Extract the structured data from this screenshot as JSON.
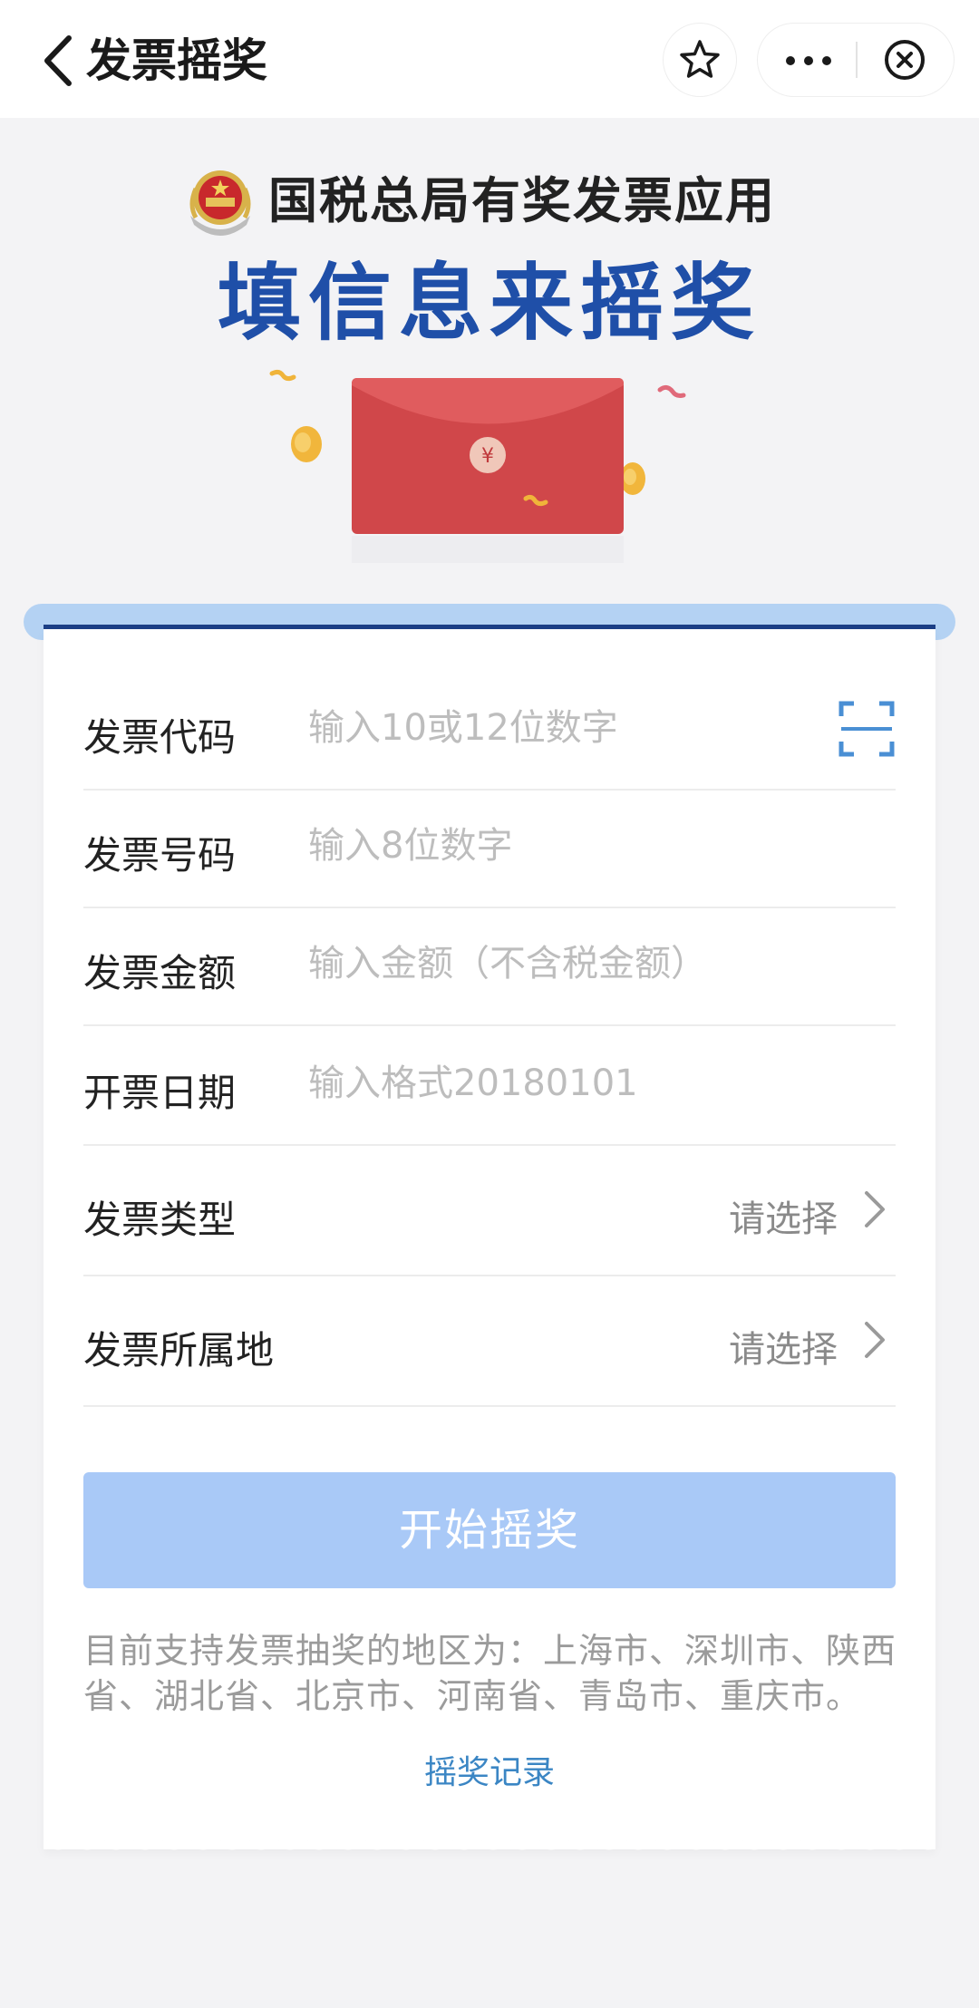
{
  "nav": {
    "title": "发票摇奖"
  },
  "banner": {
    "subtitle": "国税总局有奖发票应用",
    "headline": "填信息来摇奖",
    "envelope_symbol": "¥"
  },
  "form": {
    "fields": [
      {
        "label": "发票代码",
        "placeholder": "输入10或12位数字",
        "value": ""
      },
      {
        "label": "发票号码",
        "placeholder": "输入8位数字",
        "value": ""
      },
      {
        "label": "发票金额",
        "placeholder": "输入金额（不含税金额）",
        "value": ""
      },
      {
        "label": "开票日期",
        "placeholder": "输入格式20180101",
        "value": ""
      }
    ],
    "pickers": [
      {
        "label": "发票类型",
        "value": "请选择"
      },
      {
        "label": "发票所属地",
        "value": "请选择"
      }
    ],
    "start_button": "开始摇奖",
    "notice": "目前支持发票抽奖的地区为：上海市、深圳市、陕西省、湖北省、北京市、河南省、青岛市、重庆市。",
    "records_link": "摇奖记录"
  },
  "colors": {
    "headline": "#1f4fa8",
    "start_button": "#a9c9f7",
    "link": "#3b86c4",
    "envelope": "#d0474a"
  },
  "icons": {
    "back": "chevron-left-icon",
    "favorite": "star-icon",
    "more": "more-dots-icon",
    "close": "close-circle-icon",
    "scan": "scan-icon",
    "picker_arrow": "chevron-right-icon"
  }
}
